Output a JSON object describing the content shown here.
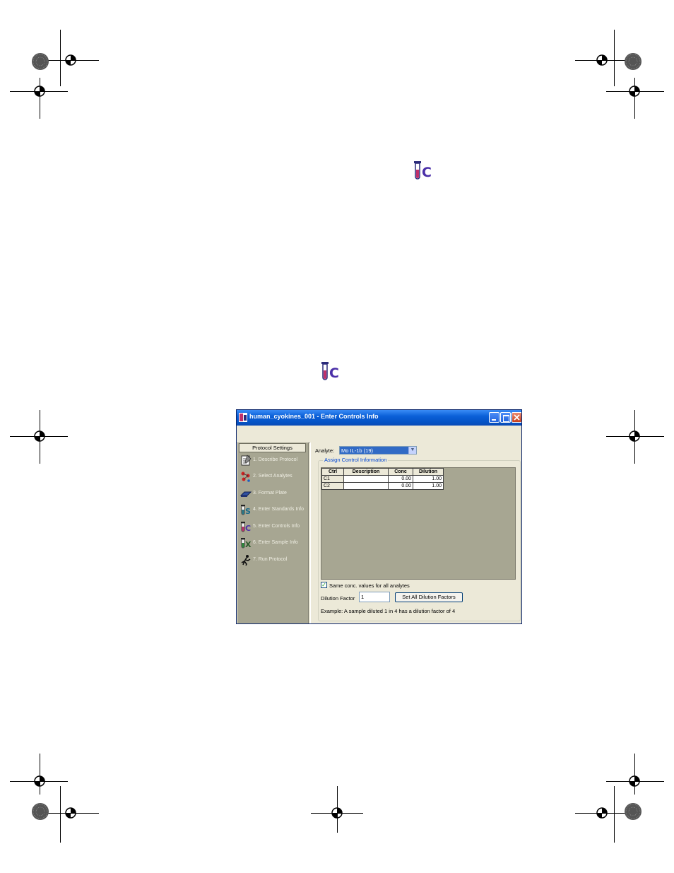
{
  "colors": {
    "titlebar": "#0553c4",
    "sidebar_bg": "#a7a692",
    "window_bg": "#ece9d8",
    "selection": "#316ac5",
    "link_blue": "#0046d5"
  },
  "window": {
    "title": "human_cyokines_001 - Enter Controls Info"
  },
  "sidebar": {
    "header": "Protocol Settings",
    "items": [
      {
        "label": "1. Describe Protocol",
        "icon": "notepad-icon"
      },
      {
        "label": "2. Select Analytes",
        "icon": "molecules-icon"
      },
      {
        "label": "3. Format Plate",
        "icon": "plate-icon"
      },
      {
        "label": "4. Enter Standards Info",
        "icon": "standards-tube-icon"
      },
      {
        "label": "5. Enter Controls Info",
        "icon": "controls-tube-icon"
      },
      {
        "label": "6. Enter Sample Info",
        "icon": "sample-tube-icon"
      },
      {
        "label": "7. Run Protocol",
        "icon": "runner-icon"
      }
    ]
  },
  "main": {
    "analyte_label": "Analyte:",
    "analyte_value": "Mo IL-1b (19)",
    "group_title": "Assign Control Information",
    "table": {
      "headers": [
        "Ctrl",
        "Description",
        "Conc",
        "Dilution"
      ],
      "rows": [
        [
          "C1",
          "",
          "0.00",
          "1.00"
        ],
        [
          "C2",
          "",
          "0.00",
          "1.00"
        ]
      ]
    },
    "same_conc_label": "Same conc. values for all analytes",
    "dilution_label": "Dilution Factor",
    "dilution_value": "1",
    "set_button": "Set All Dilution Factors",
    "example_text": "Example: A sample diluted 1 in 4 has a dilution factor of 4"
  }
}
